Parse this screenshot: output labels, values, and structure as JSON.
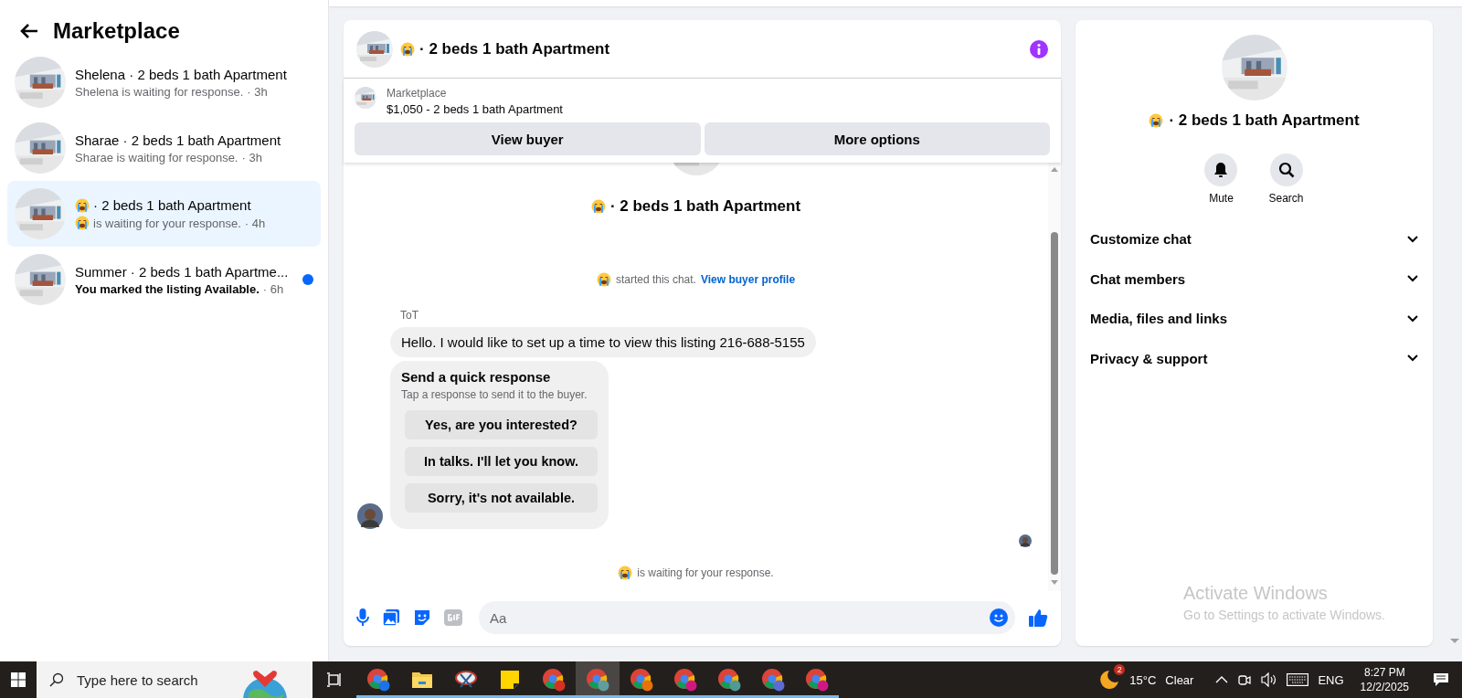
{
  "sidebar": {
    "title": "Marketplace",
    "conversations": [
      {
        "name": "Shelena · 2 beds 1 bath Apartment",
        "name_emoji": false,
        "preview": "Shelena is waiting for response.",
        "preview_emoji": false,
        "time": "· 3h",
        "selected": false,
        "unread": false
      },
      {
        "name": "Sharae · 2 beds 1 bath Apartment",
        "name_emoji": false,
        "preview": "Sharae is waiting for response.",
        "preview_emoji": false,
        "time": "· 3h",
        "selected": false,
        "unread": false
      },
      {
        "name": "· 2 beds 1 bath Apartment",
        "name_emoji": true,
        "preview": "is waiting for your response.",
        "preview_emoji": true,
        "time": "· 4h",
        "selected": true,
        "unread": false
      },
      {
        "name": "Summer · 2 beds 1 bath Apartme...",
        "name_emoji": false,
        "preview": "You marked the listing Available.",
        "preview_emoji": false,
        "time": "· 6h",
        "selected": false,
        "unread": true
      }
    ]
  },
  "chat": {
    "header": {
      "title": "· 2 beds 1 bath Apartment",
      "emoji": true
    },
    "listing": {
      "label": "Marketplace",
      "title": "$1,050 - 2 beds 1 bath Apartment"
    },
    "actions": [
      "View buyer",
      "More options"
    ],
    "thread": {
      "intro_title": "· 2 beds 1 bath Apartment",
      "intro_emoji": true,
      "system": {
        "text": "started this chat.",
        "link": "View buyer profile"
      },
      "sender": "ToT",
      "message": "Hello. I would like to set up a time to view this listing 216-688-5155",
      "quick_response": {
        "title": "Send a quick response",
        "subtitle": "Tap a response to send it to the buyer.",
        "options": [
          "Yes, are you interested?",
          "In talks. I'll let you know.",
          "Sorry, it's not available."
        ]
      },
      "status": "is waiting for your response."
    },
    "composer": {
      "placeholder": "Aa"
    }
  },
  "details": {
    "title": "· 2 beds 1 bath Apartment",
    "emoji": true,
    "actions": [
      {
        "label": "Mute",
        "kind": "bell"
      },
      {
        "label": "Search",
        "kind": "search"
      }
    ],
    "sections": [
      {
        "label": "Customize chat",
        "expanded": false
      },
      {
        "label": "Chat members",
        "expanded": false
      },
      {
        "label": "Media, files and links",
        "expanded": false
      },
      {
        "label": "Privacy & support",
        "expanded": false
      }
    ],
    "activation": {
      "title": "Activate Windows",
      "subtitle": "Go to Settings to activate Windows."
    }
  },
  "taskbar": {
    "search_placeholder": "Type here to search",
    "apps": [
      {
        "kind": "browser",
        "color": "#1a73e8",
        "active": false
      },
      {
        "kind": "folder",
        "active": false
      },
      {
        "kind": "snip",
        "active": false
      },
      {
        "kind": "notes",
        "active": false
      },
      {
        "kind": "browser",
        "color": "#d93025",
        "active": false
      },
      {
        "kind": "browser",
        "color": "#5f9ea0",
        "active": true
      },
      {
        "kind": "browser",
        "color": "#e8710a",
        "active": false
      },
      {
        "kind": "browser",
        "color": "#d01884",
        "active": false
      },
      {
        "kind": "browser",
        "color": "#4f9a94",
        "active": false
      },
      {
        "kind": "browser",
        "color": "#5b6bd8",
        "active": false
      },
      {
        "kind": "browser",
        "color": "#d01884",
        "active": false
      }
    ],
    "weather": {
      "badge": "2",
      "temp": "15°C",
      "condition": "Clear"
    },
    "language": "ENG",
    "time": "8:27 PM",
    "date": "12/2/2025"
  }
}
